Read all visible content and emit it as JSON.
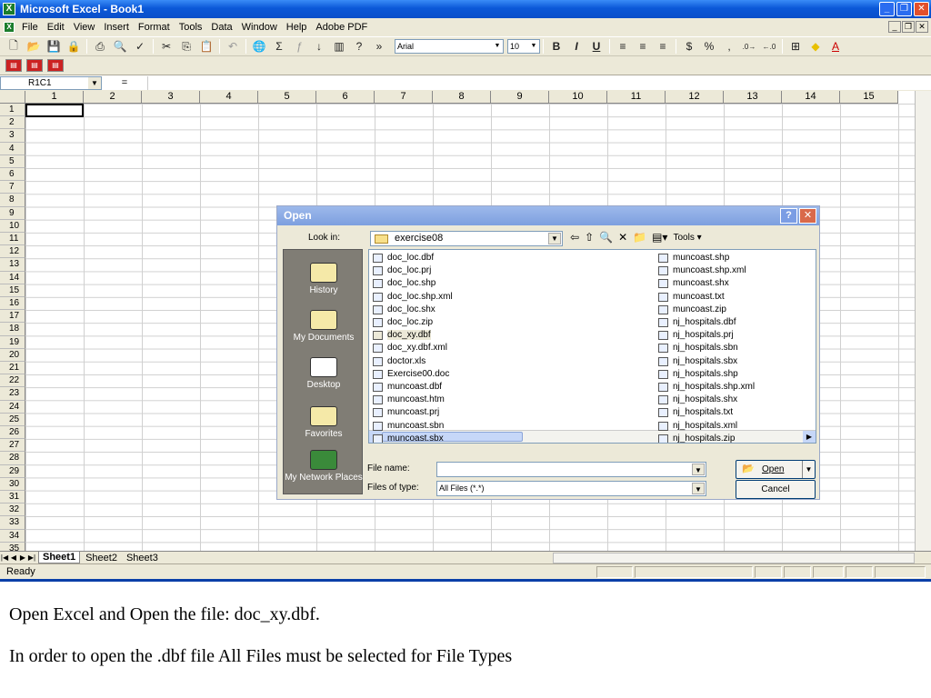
{
  "window": {
    "title": "Microsoft Excel - Book1"
  },
  "menu": [
    "File",
    "Edit",
    "View",
    "Insert",
    "Format",
    "Tools",
    "Data",
    "Window",
    "Help",
    "Adobe PDF"
  ],
  "toolbar": {
    "font_name": "Arial",
    "font_size": "10",
    "bold": "B",
    "italic": "I",
    "underline": "U"
  },
  "formula_bar": {
    "name_box": "R1C1",
    "equals": "="
  },
  "grid": {
    "columns": [
      "1",
      "2",
      "3",
      "4",
      "5",
      "6",
      "7",
      "8",
      "9",
      "10",
      "11",
      "12",
      "13",
      "14",
      "15"
    ],
    "rows": [
      "1",
      "2",
      "3",
      "4",
      "5",
      "6",
      "7",
      "8",
      "9",
      "10",
      "11",
      "12",
      "13",
      "14",
      "15",
      "16",
      "17",
      "18",
      "19",
      "20",
      "21",
      "22",
      "23",
      "24",
      "25",
      "26",
      "27",
      "28",
      "29",
      "30",
      "31",
      "32",
      "33",
      "34",
      "35"
    ]
  },
  "sheets": [
    "Sheet1",
    "Sheet2",
    "Sheet3"
  ],
  "status": "Ready",
  "dialog": {
    "title": "Open",
    "look_in_label": "Look in:",
    "look_in_value": "exercise08",
    "tools_label": "Tools",
    "places": [
      "History",
      "My Documents",
      "Desktop",
      "Favorites",
      "My Network Places"
    ],
    "files_left": [
      "doc_loc.dbf",
      "doc_loc.prj",
      "doc_loc.shp",
      "doc_loc.shp.xml",
      "doc_loc.shx",
      "doc_loc.zip",
      "doc_xy.dbf",
      "doc_xy.dbf.xml",
      "doctor.xls",
      "Exercise00.doc",
      "muncoast.dbf",
      "muncoast.htm",
      "muncoast.prj",
      "muncoast.sbn",
      "muncoast.sbx"
    ],
    "files_right": [
      "muncoast.shp",
      "muncoast.shp.xml",
      "muncoast.shx",
      "muncoast.txt",
      "muncoast.zip",
      "nj_hospitals.dbf",
      "nj_hospitals.prj",
      "nj_hospitals.sbn",
      "nj_hospitals.sbx",
      "nj_hospitals.shp",
      "nj_hospitals.shp.xml",
      "nj_hospitals.shx",
      "nj_hospitals.txt",
      "nj_hospitals.xml",
      "nj_hospitals.zip"
    ],
    "selected_file": "doc_xy.dbf",
    "file_name_label": "File name:",
    "file_name_value": "",
    "file_type_label": "Files of type:",
    "file_type_value": "All Files (*.*)",
    "open_button": "Open",
    "cancel_button": "Cancel"
  },
  "caption": {
    "line1": "Open Excel and Open the file: doc_xy.dbf.",
    "line2": "In order to open the .dbf file All Files must be selected for File Types"
  }
}
